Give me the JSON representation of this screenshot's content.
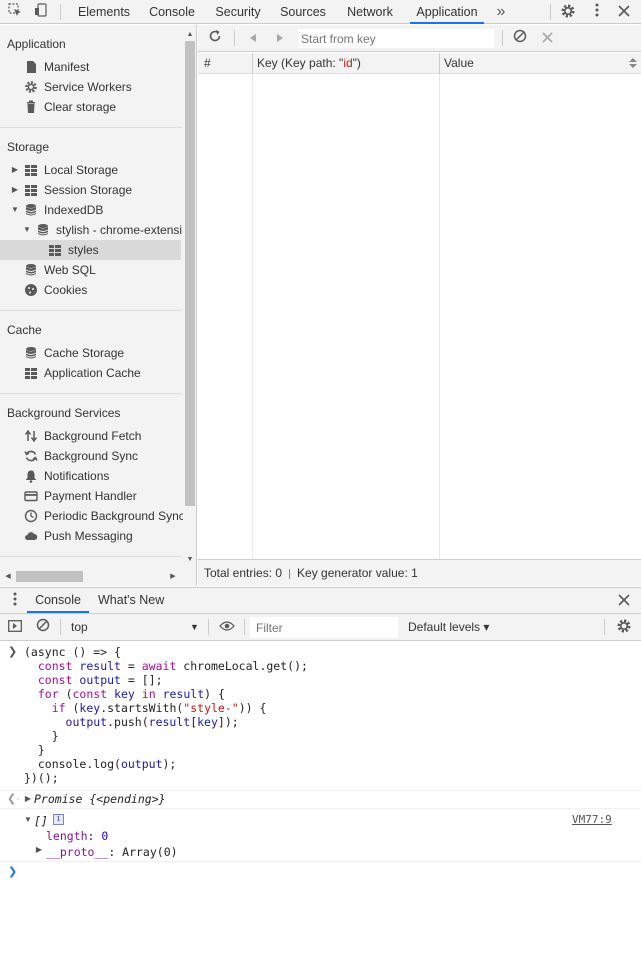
{
  "topbar": {
    "tabs": [
      {
        "label": "Elements",
        "active": false
      },
      {
        "label": "Console",
        "active": false
      },
      {
        "label": "Security",
        "active": false
      },
      {
        "label": "Sources",
        "active": false
      },
      {
        "label": "Network",
        "active": false
      },
      {
        "label": "Application",
        "active": true
      }
    ],
    "more_label": "»"
  },
  "sidebar": {
    "application": {
      "heading": "Application",
      "items": [
        "Manifest",
        "Service Workers",
        "Clear storage"
      ]
    },
    "storage": {
      "heading": "Storage",
      "items": [
        {
          "label": "Local Storage"
        },
        {
          "label": "Session Storage"
        },
        {
          "label": "IndexedDB"
        },
        {
          "label": "stylish - chrome-extensi"
        },
        {
          "label": "styles",
          "selected": true
        },
        {
          "label": "Web SQL"
        },
        {
          "label": "Cookies"
        }
      ]
    },
    "cache": {
      "heading": "Cache",
      "items": [
        "Cache Storage",
        "Application Cache"
      ]
    },
    "background": {
      "heading": "Background Services",
      "items": [
        "Background Fetch",
        "Background Sync",
        "Notifications",
        "Payment Handler",
        "Periodic Background Sync",
        "Push Messaging"
      ]
    }
  },
  "main": {
    "key_placeholder": "Start from key",
    "columns": {
      "index": "#",
      "key_prefix": "Key (Key path: \"",
      "key_path": "id",
      "key_suffix": "\")",
      "value": "Value"
    },
    "status": {
      "entries": "Total entries: 0",
      "keygen": "Key generator value: 1"
    }
  },
  "drawer": {
    "tabs": [
      {
        "label": "Console",
        "active": true
      },
      {
        "label": "What's New",
        "active": false
      }
    ],
    "context": "top",
    "filter_placeholder": "Filter",
    "levels": "Default levels ▾"
  },
  "console": {
    "code": {
      "l1a": "(async () => {",
      "l2_const": "const",
      "l2_var": "result",
      "l2_eq": " = ",
      "l2_kw": "await",
      "l2_rest": " chromeLocal.get();",
      "l3_const": "const",
      "l3_var": "output",
      "l3_rest": " = [];",
      "l4_for": "for",
      "l4_open": " (",
      "l4_const": "const",
      "l4_key": "key",
      "l4_in": "in",
      "l4_result": "result",
      "l4_close": ") {",
      "l5_if": "if",
      "l5_open": " (",
      "l5_key": "key",
      "l5_mid": ".startsWith(",
      "l5_str": "\"style-\"",
      "l5_close": ")) {",
      "l6_output": "output",
      "l6_mid": ".push(",
      "l6_result": "result",
      "l6_br": "[",
      "l6_key": "key",
      "l6_close": "]);",
      "l7": "}",
      "l8": "}",
      "l9_pre": "console.log(",
      "l9_var": "output",
      "l9_close": ");",
      "l10": "})();"
    },
    "promise": "Promise {<pending>}",
    "array_label": "[]",
    "info_badge": "i",
    "source_link": "VM77:9",
    "length_key": "length",
    "length_val": "0",
    "proto_key": "__proto__",
    "proto_val": ": Array(0)"
  }
}
